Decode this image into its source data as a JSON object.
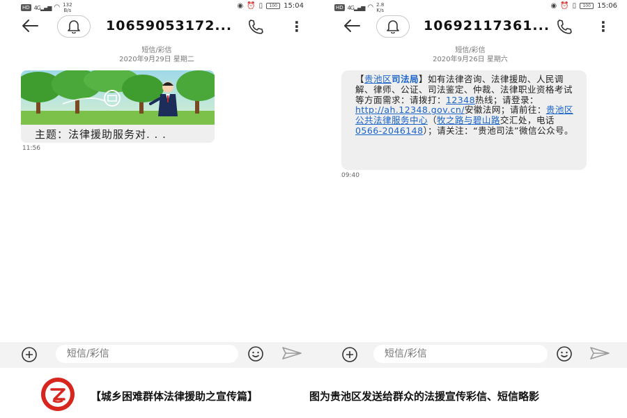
{
  "left_phone": {
    "status_bar": {
      "net_badge": "HD",
      "signal_label": "4G",
      "speed_value": "132",
      "speed_unit": "B/s",
      "battery": "100",
      "time": "15:04"
    },
    "header": {
      "contact": "10659053172..."
    },
    "date_header": {
      "type": "短信/彩信",
      "date": "2020年9月29日 星期二"
    },
    "mms": {
      "subject": "主题：法律援助服务对. . .",
      "image_icon": "cartoon-lawyer-trees-image",
      "time": "11:56"
    },
    "composer": {
      "placeholder": "短信/彩信"
    }
  },
  "right_phone": {
    "status_bar": {
      "net_badge": "HD",
      "signal_label": "4G",
      "speed_value": "2.8",
      "speed_unit": "K/s",
      "battery": "100",
      "time": "15:06"
    },
    "header": {
      "contact": "10692117361..."
    },
    "date_header": {
      "type": "短信/彩信",
      "date": "2020年9月26日 星期六"
    },
    "sms": {
      "bracket_open": "【",
      "sender_place": "贵池区",
      "sender_org": "司法局",
      "part1": "】如有法律咨询、法律援助、人民调解、律师、公证、司法鉴定、仲裁、法律职业资格考试等方面需求：请拨打：",
      "hotline": "12348",
      "part2": "热线；请登录：",
      "url": "http://ah.12348.gov.cn/",
      "part3": "安徽法网；请前往：",
      "center": "贵池区公共法律服务中心",
      "part4": "（",
      "road": "牧之路与碧山路",
      "part5": "交汇处，电话",
      "phone": "0566-2046148",
      "part6": "）；请关注：“贵池司法”微信公众号。",
      "time": "09:40"
    },
    "composer": {
      "placeholder": "短信/彩信"
    }
  },
  "caption": {
    "seal_icon": "red-circular-seal-logo",
    "title": "【城乡困难群体法律援助之宣传篇】",
    "text": "图为贵池区发送给群众的法援宣传彩信、短信略影"
  },
  "colors": {
    "link": "#1a63c9",
    "bubble": "#efefef",
    "seal": "#d7261e"
  }
}
